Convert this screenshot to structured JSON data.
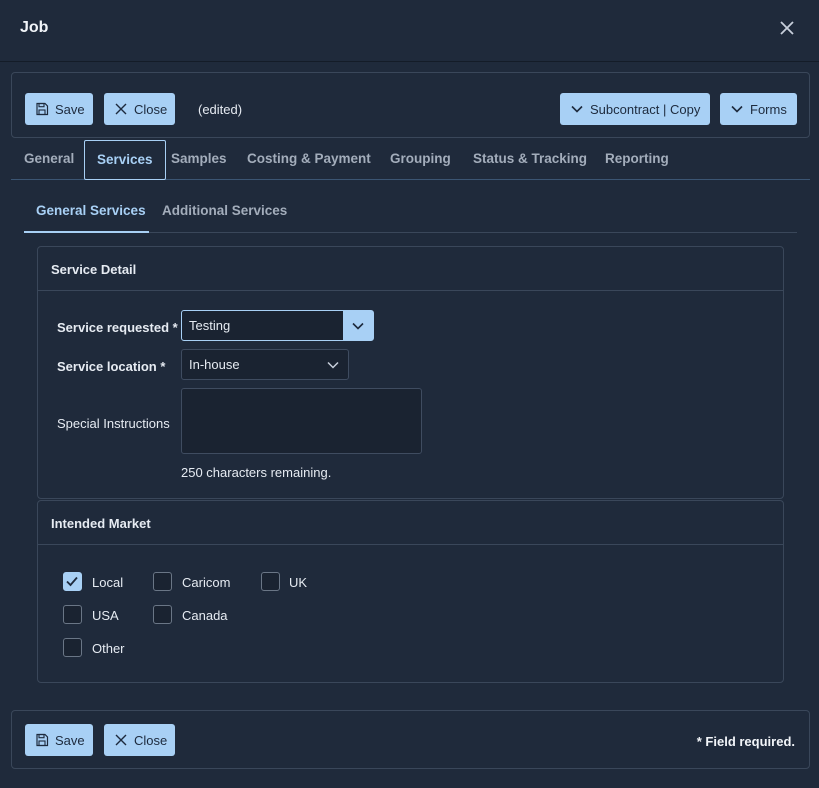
{
  "dialog": {
    "title": "Job",
    "close_icon": "close-icon"
  },
  "toolbar": {
    "save_label": "Save",
    "close_label": "Close",
    "status_text": "(edited)",
    "subcontract_label": "Subcontract | Copy",
    "forms_label": "Forms"
  },
  "tabs": [
    {
      "label": "General"
    },
    {
      "label": "Services",
      "active": true
    },
    {
      "label": "Samples"
    },
    {
      "label": "Costing & Payment"
    },
    {
      "label": "Grouping"
    },
    {
      "label": "Status & Tracking"
    },
    {
      "label": "Reporting"
    }
  ],
  "subtabs": [
    {
      "label": "General Services",
      "active": true
    },
    {
      "label": "Additional Services"
    }
  ],
  "service_detail": {
    "title": "Service Detail",
    "service_requested_label": "Service requested *",
    "service_requested_value": "Testing",
    "service_location_label": "Service location *",
    "service_location_value": "In-house",
    "special_instructions_label": "Special Instructions",
    "special_instructions_value": "",
    "chars_remaining": "250 characters remaining."
  },
  "intended_market": {
    "title": "Intended Market",
    "options": [
      {
        "label": "Local",
        "checked": true
      },
      {
        "label": "Caricom",
        "checked": false
      },
      {
        "label": "UK",
        "checked": false
      },
      {
        "label": "USA",
        "checked": false
      },
      {
        "label": "Canada",
        "checked": false
      },
      {
        "label": "Other",
        "checked": false
      }
    ]
  },
  "footer": {
    "save_label": "Save",
    "close_label": "Close",
    "required_note": "* Field required."
  },
  "colors": {
    "background": "#1f2a3b",
    "accent": "#a8d0f5",
    "border": "#3a475a",
    "input_bg": "#1a2331"
  }
}
